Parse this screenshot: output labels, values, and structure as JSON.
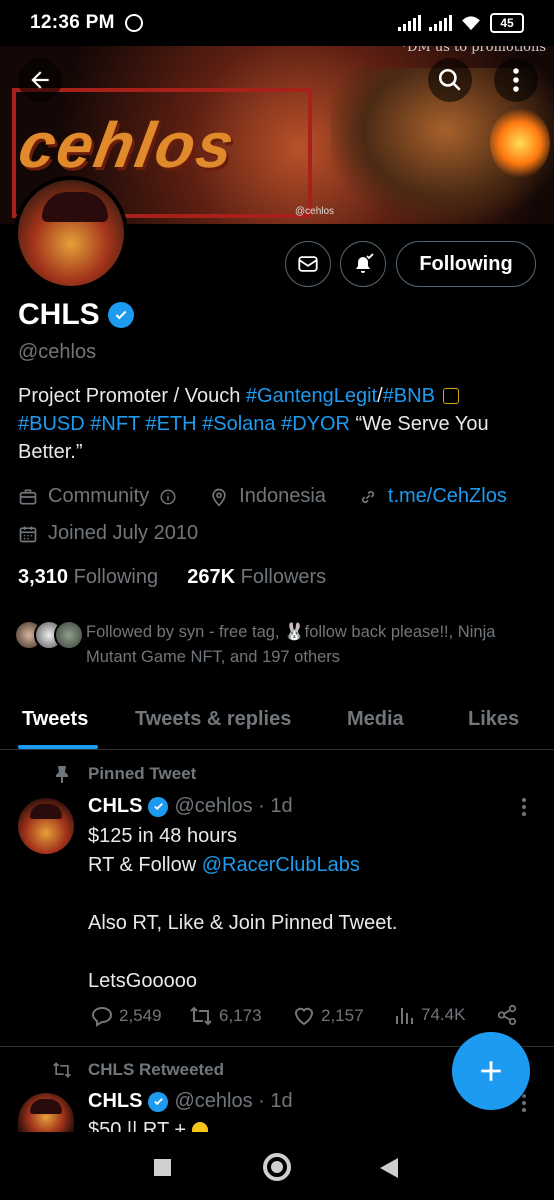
{
  "status_bar": {
    "time": "12:36 PM",
    "battery": "45"
  },
  "banner": {
    "promo_text": "*DM us to promotions",
    "logo_text": "cehlos",
    "handle_tag": "@cehlos"
  },
  "profile": {
    "name": "CHLS",
    "handle": "@cehlos",
    "following_button": "Following",
    "bio": {
      "line1_prefix": "Project Promoter / Vouch ",
      "tag1": "#GantengLegit",
      "slash": "/",
      "tag2": "#BNB",
      "line2_tags": "#BUSD #NFT #ETH #Solana #DYOR",
      "line2_suffix": " “We Serve You Better.”"
    },
    "category": "Community",
    "location": "Indonesia",
    "link": "t.me/CehZlos",
    "joined": "Joined July 2010",
    "following_count": "3,310",
    "following_label": "Following",
    "followers_count": "267K",
    "followers_label": "Followers",
    "followed_by_prefix": "Followed by syn - free tag, ",
    "followed_by_rest": "follow back please!!, Ninja Mutant Game NFT, and 197 others"
  },
  "tabs": [
    {
      "label": "Tweets",
      "active": true
    },
    {
      "label": "Tweets & replies",
      "active": false
    },
    {
      "label": "Media",
      "active": false
    },
    {
      "label": "Likes",
      "active": false
    }
  ],
  "pinned_tweet": {
    "label": "Pinned Tweet",
    "author": "CHLS",
    "handle_time": "@cehlos · 1d",
    "line1": "$125 in 48 hours",
    "line2_prefix": "RT & Follow ",
    "mention": "@RacerClubLabs",
    "line3": "Also RT, Like & Join Pinned Tweet.",
    "line4": "LetsGooooo",
    "replies": "2,549",
    "retweets": "6,173",
    "likes": "2,157",
    "views": "74.4K"
  },
  "retweet": {
    "label": "CHLS Retweeted",
    "author": "CHLS",
    "handle_time": "@cehlos · 1d",
    "text": "$50 || RT + "
  },
  "colors": {
    "accent": "#1d9bf0",
    "background": "#000000",
    "secondary_text": "#71767b"
  }
}
